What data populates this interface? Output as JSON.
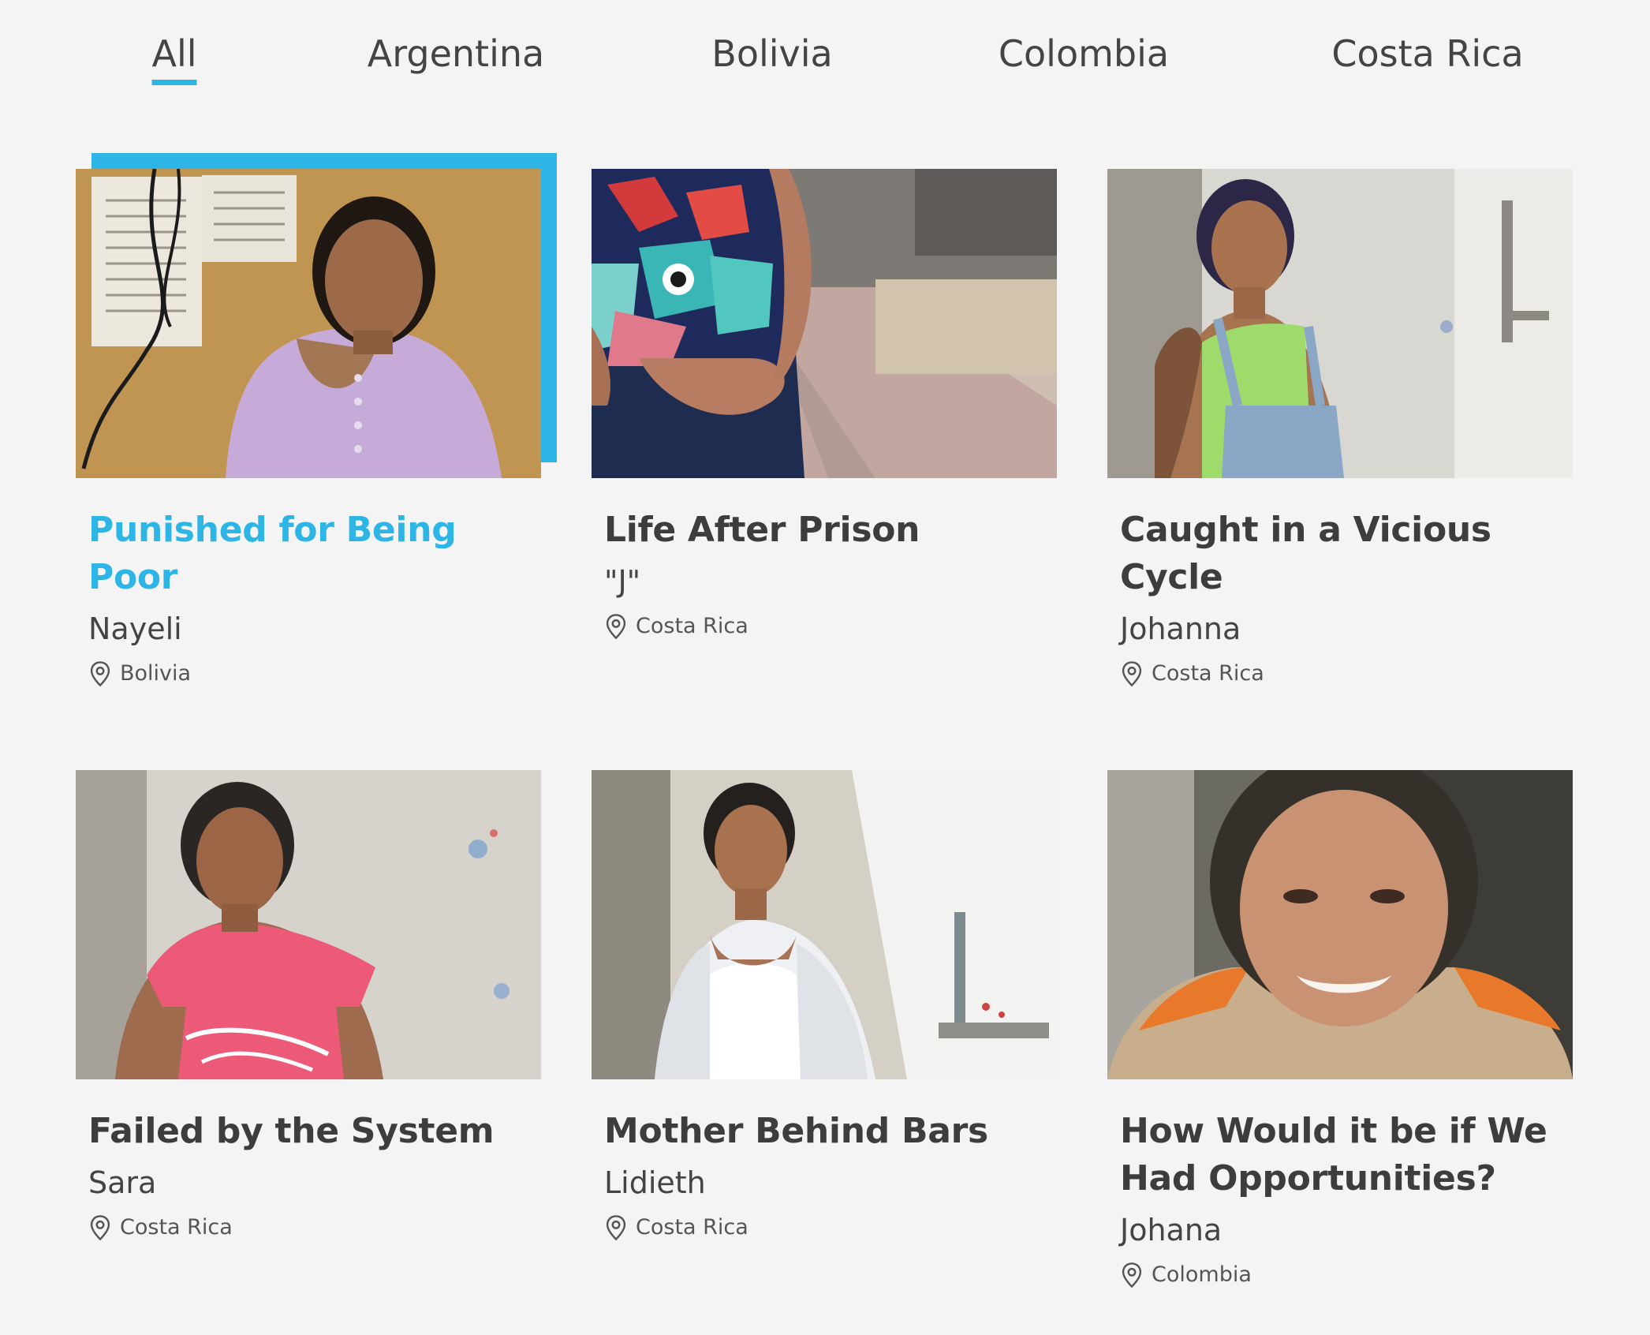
{
  "filters": {
    "tabs": [
      {
        "label": "All",
        "active": true
      },
      {
        "label": "Argentina",
        "active": false
      },
      {
        "label": "Bolivia",
        "active": false
      },
      {
        "label": "Colombia",
        "active": false
      },
      {
        "label": "Costa Rica",
        "active": false
      }
    ]
  },
  "accent_color": "#2db5e6",
  "stories": [
    {
      "title": "Punished for Being Poor",
      "person": "Nayeli",
      "location": "Bolivia",
      "highlighted": true,
      "photo": "portrait-woman-lilac-blouse"
    },
    {
      "title": "Life After Prison",
      "person": "\"J\"",
      "location": "Costa Rica",
      "highlighted": false,
      "photo": "torso-patterned-shirt-courtyard"
    },
    {
      "title": "Caught in a Vicious Cycle",
      "person": "Johanna",
      "location": "Costa Rica",
      "highlighted": false,
      "photo": "woman-overalls-wall"
    },
    {
      "title": "Failed by the System",
      "person": "Sara",
      "location": "Costa Rica",
      "highlighted": false,
      "photo": "woman-pink-tshirt"
    },
    {
      "title": "Mother Behind Bars",
      "person": "Lidieth",
      "location": "Costa Rica",
      "highlighted": false,
      "photo": "woman-white-jacket"
    },
    {
      "title": "How Would it be if We Had Opportunities?",
      "person": "Johana",
      "location": "Colombia",
      "highlighted": false,
      "photo": "woman-smiling-closeup"
    }
  ],
  "icons": {
    "location": "map-pin-icon"
  }
}
